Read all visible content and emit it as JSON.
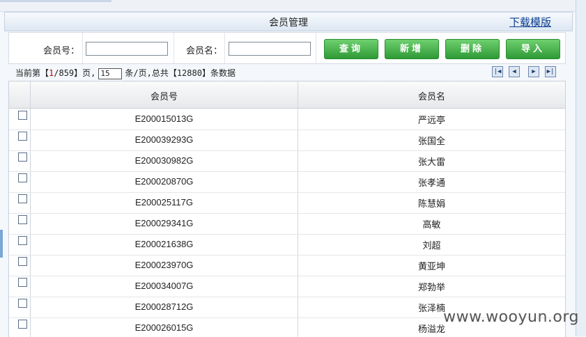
{
  "header": {
    "title": "会员管理",
    "download_label": "下载模版"
  },
  "search": {
    "member_no_label": "会员号：",
    "member_name_label": "会员名：",
    "member_no_value": "",
    "member_name_value": ""
  },
  "buttons": {
    "query": "查询",
    "add": "新增",
    "delete": "删除",
    "import": "导入"
  },
  "pager": {
    "prefix": "当前第【",
    "current_page": "1",
    "total_pages_text": "/859】页,",
    "page_size": "15",
    "middle": "条/页,总共【",
    "total_records": "12880",
    "suffix": "】条数据"
  },
  "table": {
    "columns": [
      "会员号",
      "会员名"
    ],
    "rows": [
      {
        "no": "E200015013G",
        "name": "严远亭"
      },
      {
        "no": "E200039293G",
        "name": "张国全"
      },
      {
        "no": "E200030982G",
        "name": "张大雷"
      },
      {
        "no": "E200020870G",
        "name": "张孝通"
      },
      {
        "no": "E200025117G",
        "name": "陈慧娟"
      },
      {
        "no": "E200029341G",
        "name": "高敏"
      },
      {
        "no": "E200021638G",
        "name": "刘超"
      },
      {
        "no": "E200023970G",
        "name": "黄亚坤"
      },
      {
        "no": "E200034007G",
        "name": "郑勃举"
      },
      {
        "no": "E200028712G",
        "name": "张泽楠"
      },
      {
        "no": "E200026015G",
        "name": "杨溢龙"
      }
    ]
  },
  "watermark": "www.wooyun.org"
}
